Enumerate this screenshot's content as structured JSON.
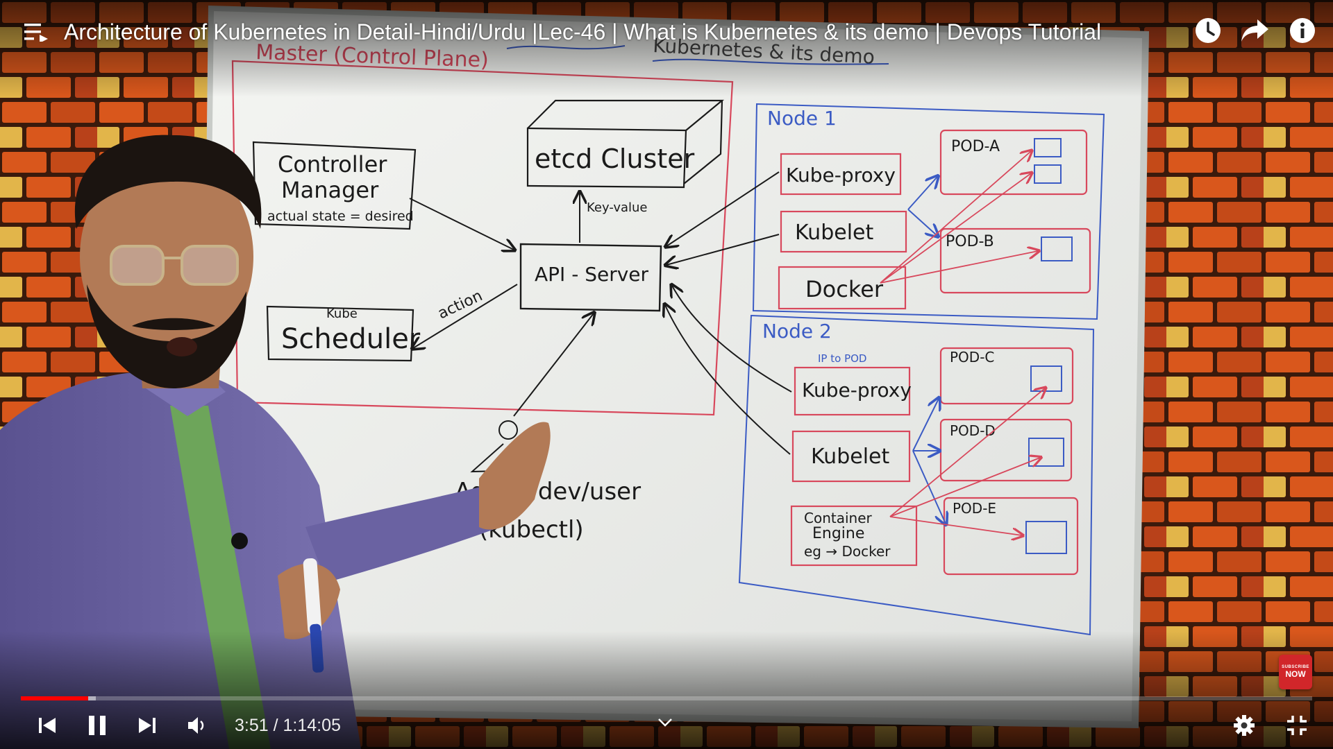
{
  "header": {
    "title": "Architecture of Kubernetes in Detail-Hindi/Urdu |Lec-46 | What is Kubernetes & its demo | Devops Tutorial"
  },
  "board": {
    "master_label": "Master (Control Plane)",
    "heading_fragment": "Kubernetes & its demo",
    "controller_manager": {
      "line1": "Controller",
      "line2": "Manager",
      "line3": "actual state = desired"
    },
    "etcd": "etcd Cluster",
    "key_value": "Key-value",
    "api_server": "API - Server",
    "scheduler": {
      "small": "Kube",
      "main": "Scheduler"
    },
    "action": "action",
    "admin": {
      "line1": "Admin/dev/user",
      "line2": "(kubectl)"
    },
    "node1": {
      "label": "Node 1",
      "kube_proxy": "Kube-proxy",
      "kubelet": "Kubelet",
      "docker": "Docker",
      "pod_a": "POD-A",
      "pod_b": "POD-B"
    },
    "node2": {
      "label": "Node 2",
      "ip_note": "IP to POD",
      "kube_proxy": "Kube-proxy",
      "kubelet": "Kubelet",
      "engine": {
        "line1": "Container",
        "line2": "Engine",
        "line3": "eg → Docker"
      },
      "pod_c": "POD-C",
      "pod_d": "POD-D",
      "pod_e": "POD-E"
    }
  },
  "subscribe_badge": {
    "line1": "SUBSCRIBE",
    "line2": "NOW"
  },
  "player": {
    "current_time": "3:51",
    "duration": "1:14:05",
    "time_display": "3:51 / 1:14:05",
    "progress_played": 0.052,
    "progress_buffered": 0.058
  },
  "icons": {
    "menu": "menu-icon",
    "watch_later": "clock-icon",
    "share": "share-icon",
    "info": "info-icon",
    "prev": "previous-icon",
    "pause": "pause-icon",
    "next": "next-icon",
    "volume": "volume-icon",
    "chevron": "chevron-down-icon",
    "settings": "gear-icon",
    "exit_fullscreen": "exit-fullscreen-icon"
  },
  "colors": {
    "progress_red": "#ff0000",
    "ink_black": "#1a1a1a",
    "ink_red": "#d8485c",
    "ink_blue": "#3b5bc4",
    "brick": "#d4551f"
  }
}
